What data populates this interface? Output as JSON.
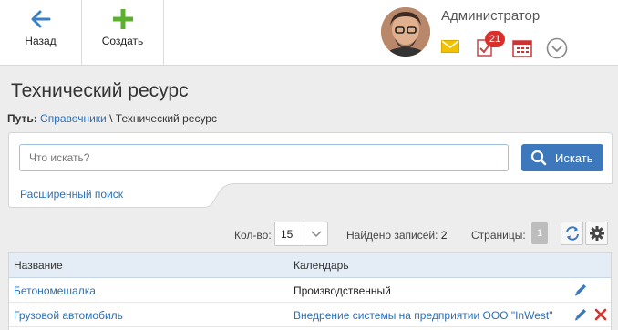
{
  "toolbar": {
    "back_label": "Назад",
    "create_label": "Создать"
  },
  "user": {
    "name": "Администратор",
    "notifications_count": "21"
  },
  "page": {
    "title": "Технический ресурс",
    "breadcrumb": {
      "prefix": "Путь:",
      "link": "Справочники",
      "separator": "\\",
      "current": "Технический ресурс"
    }
  },
  "search": {
    "placeholder": "Что искать?",
    "button_label": "Искать",
    "advanced_label": "Расширенный поиск"
  },
  "controls": {
    "count_label": "Кол-во:",
    "count_value": "15",
    "found_label": "Найдено записей:",
    "found_value": "2",
    "pages_label": "Страницы:",
    "current_page": "1"
  },
  "table": {
    "columns": [
      "Название",
      "Календарь"
    ],
    "rows": [
      {
        "name": "Бетономешалка",
        "calendar": "Производственный"
      },
      {
        "name": "Грузовой автомобиль",
        "calendar": "Внедрение системы на предприятии ООО \"InWest\""
      }
    ]
  },
  "colors": {
    "accent": "#3d78bd",
    "link": "#2d6fb5",
    "back_arrow": "#3b7fc4",
    "create_plus": "#5cb030",
    "delete": "#d9302c",
    "mail": "#f2c200"
  },
  "icons": [
    "arrow-left-icon",
    "plus-icon",
    "mail-icon",
    "tasks-icon",
    "calendar-icon",
    "chevron-down-icon",
    "search-icon",
    "refresh-icon",
    "gear-icon",
    "pencil-icon",
    "delete-icon"
  ]
}
